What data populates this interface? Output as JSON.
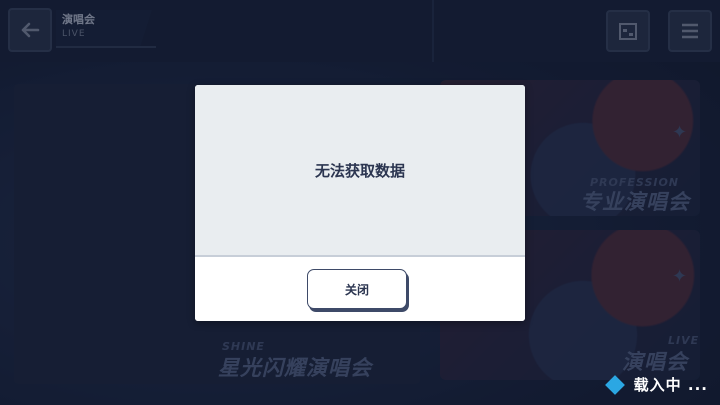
{
  "header": {
    "title": "演唱会",
    "subtitle": "LIVE"
  },
  "cards": [
    {
      "tag": "PROFESSION",
      "title": "专业演唱会"
    },
    {
      "tag": "LIVE",
      "title": "演唱会"
    },
    {
      "tag": "SHINE",
      "title": "星光闪耀演唱会"
    }
  ],
  "dialog": {
    "message": "无法获取数据",
    "close_label": "关闭"
  },
  "loading": {
    "text": "载入中 ..."
  },
  "colors": {
    "dialog_bg": "#e9edf0",
    "button_border": "#3e4a68",
    "loading_icon": "#2ba7e3",
    "background": "#1d2a44"
  },
  "icons": {
    "back": "arrow-left-icon",
    "calendar": "calendar-icon",
    "menu": "menu-icon",
    "loading": "diamond-icon"
  }
}
